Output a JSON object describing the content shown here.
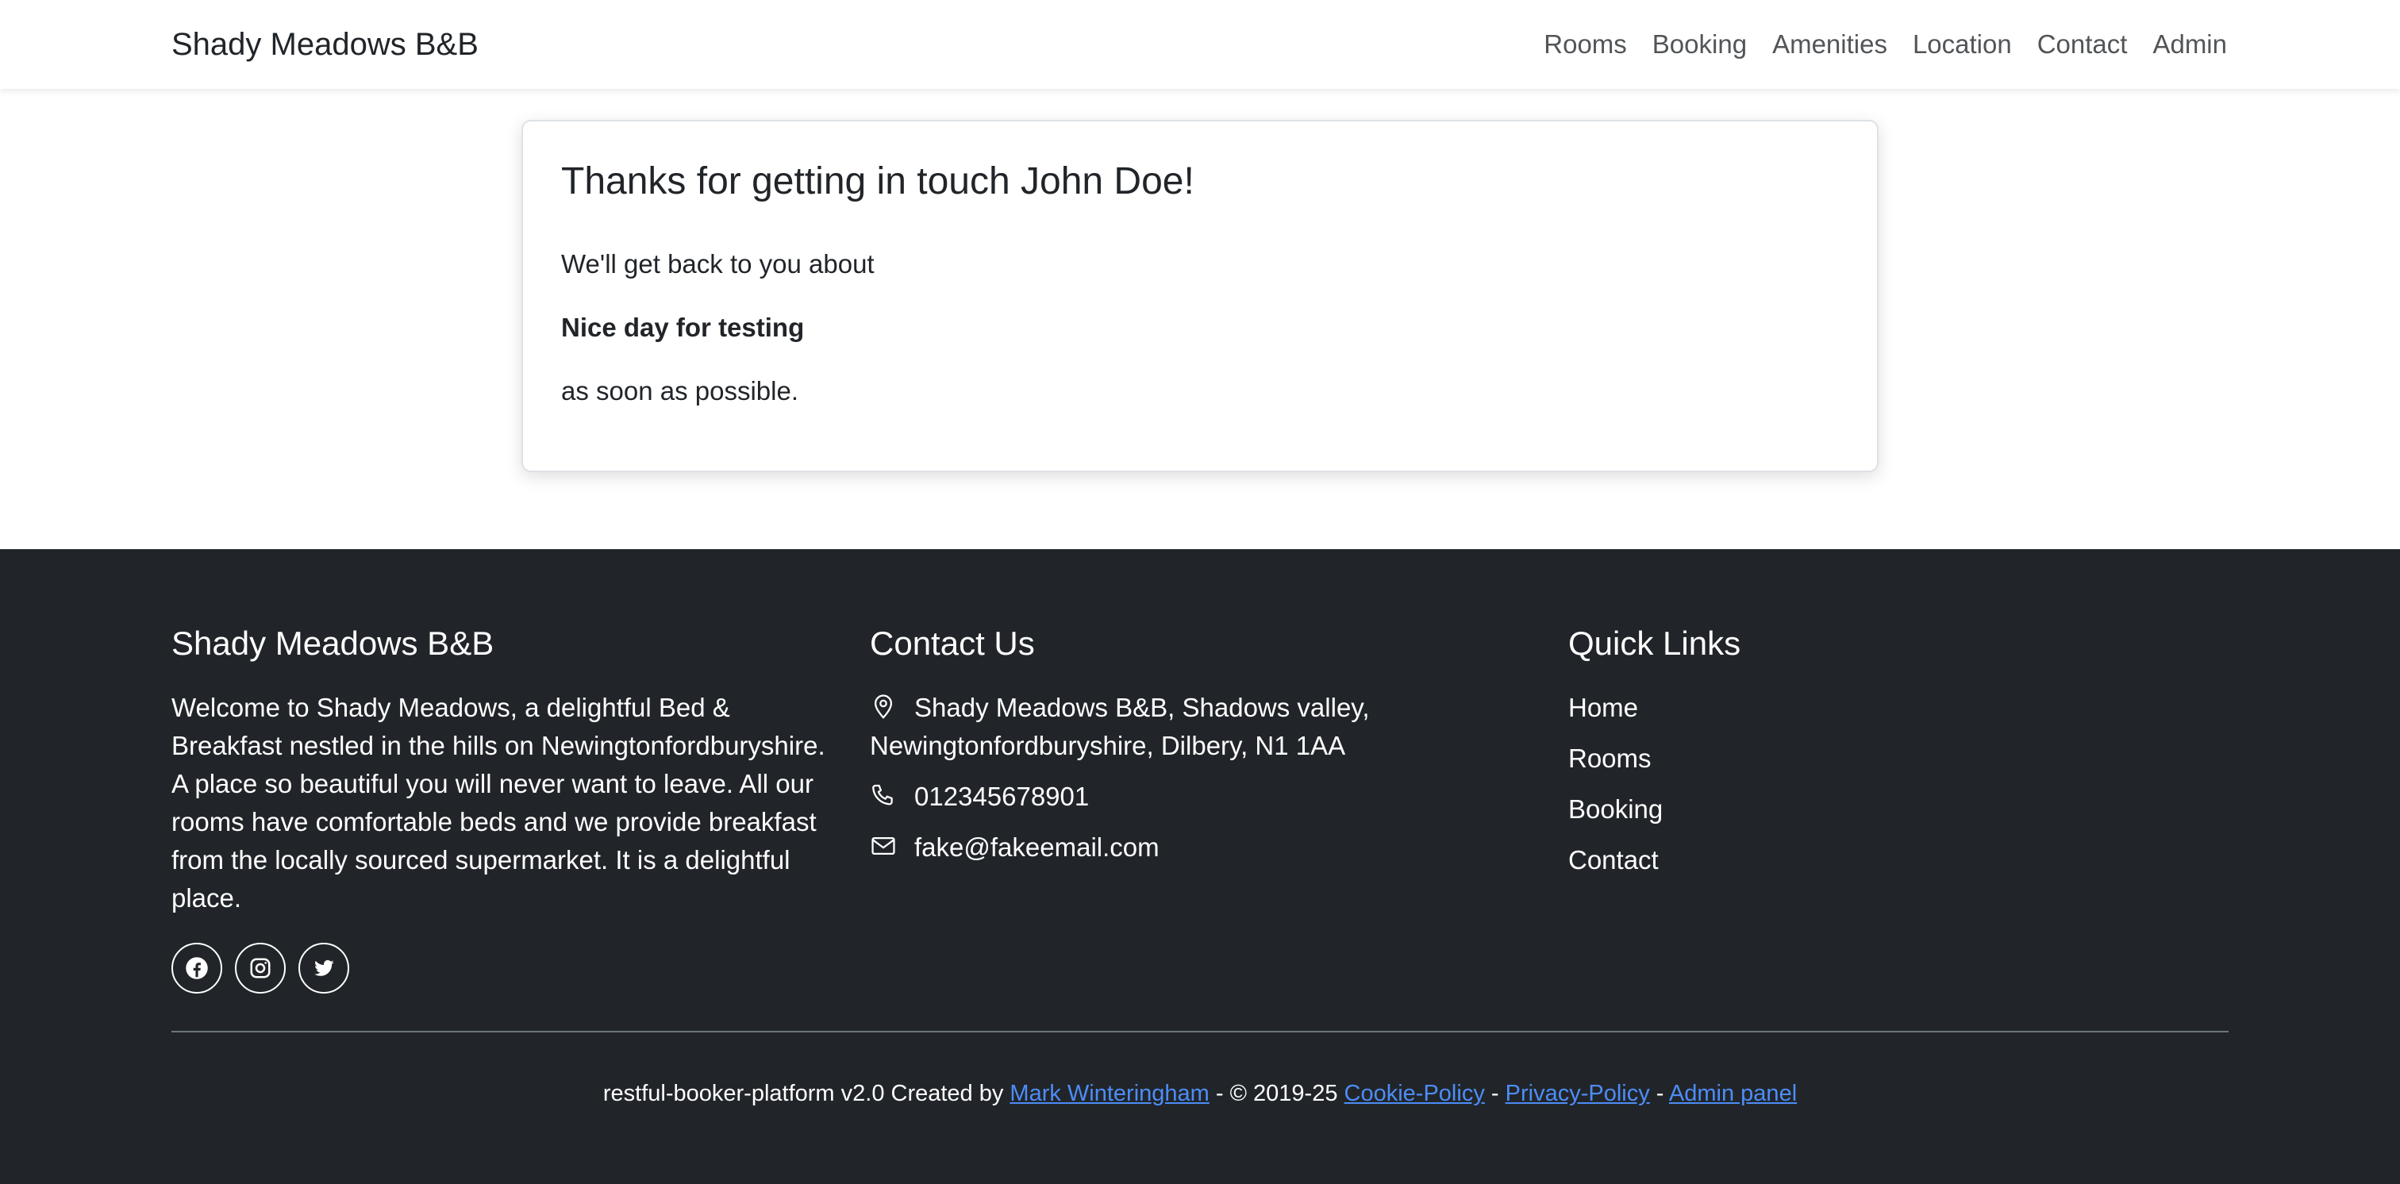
{
  "navbar": {
    "brand": "Shady Meadows B&B",
    "links": [
      "Rooms",
      "Booking",
      "Amenities",
      "Location",
      "Contact",
      "Admin"
    ]
  },
  "confirmation": {
    "title": "Thanks for getting in touch John Doe!",
    "line1": "We'll get back to you about",
    "subject": "Nice day for testing",
    "line3": "as soon as possible."
  },
  "footer": {
    "about": {
      "heading": "Shady Meadows B&B",
      "text": "Welcome to Shady Meadows, a delightful Bed & Breakfast nestled in the hills on Newingtonfordburyshire. A place so beautiful you will never want to leave. All our rooms have comfortable beds and we provide breakfast from the locally sourced supermarket. It is a delightful place."
    },
    "social": [
      "facebook-icon",
      "instagram-icon",
      "twitter-icon"
    ],
    "contact": {
      "heading": "Contact Us",
      "address": "Shady Meadows B&B, Shadows valley, Newingtonfordburyshire, Dilbery, N1 1AA",
      "phone": "012345678901",
      "email": "fake@fakeemail.com"
    },
    "quick_links": {
      "heading": "Quick Links",
      "items": [
        "Home",
        "Rooms",
        "Booking",
        "Contact"
      ]
    },
    "copyright": {
      "prefix": "restful-booker-platform v2.0 Created by",
      "author": "Mark Winteringham",
      "years": "- © 2019-25",
      "cookie": "Cookie-Policy",
      "sep": "-",
      "privacy": "Privacy-Policy",
      "admin": "Admin panel"
    },
    "link_color": "#4d8df7"
  },
  "colors": {
    "footer_bg": "#212529",
    "text": "#212529"
  }
}
